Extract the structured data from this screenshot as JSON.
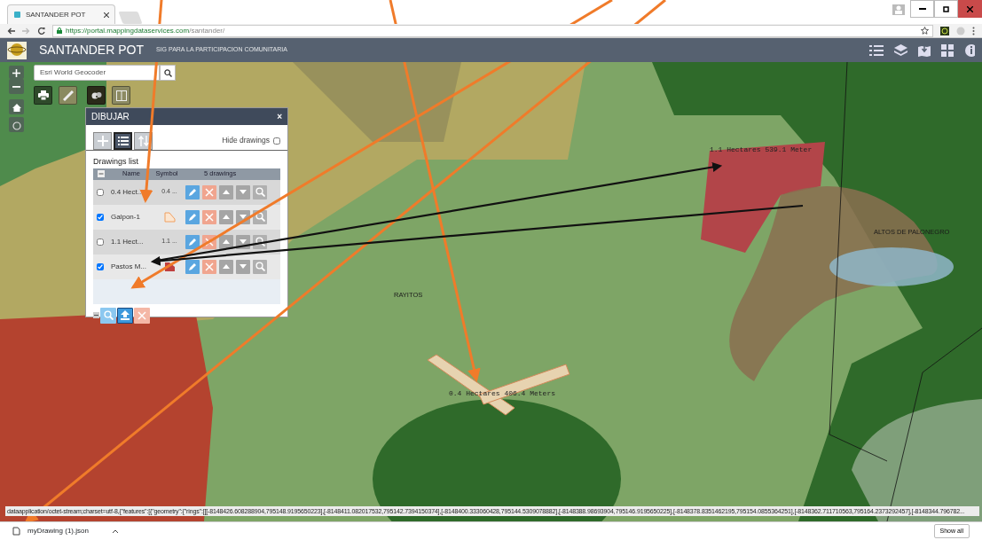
{
  "browser": {
    "tab_title": "SANTANDER POT",
    "url_host": "https://portal.mappingdataservices.com",
    "url_path": "/santander/"
  },
  "app": {
    "title": "SANTANDER POT",
    "subtitle": "SIG PARA LA PARTICIPACION COMUNITARIA"
  },
  "search": {
    "placeholder": "Esri World Geocoder"
  },
  "panel": {
    "title": "DIBUJAR",
    "close": "×",
    "tabs": [
      {
        "kind": "add",
        "selected": false
      },
      {
        "kind": "list",
        "selected": true
      },
      {
        "kind": "import",
        "selected": false
      }
    ],
    "hide_drawings": {
      "label": "Hide drawings",
      "checked": false
    },
    "list_title": "Drawings list",
    "columns": [
      "Name",
      "Symbol",
      "5 drawings"
    ],
    "rows": [
      {
        "name": "0.4 Hect...",
        "checked": false,
        "kind": "text",
        "symbol_text": "0.4 ..."
      },
      {
        "name": "Galpon-1",
        "checked": true,
        "kind": "outline"
      },
      {
        "name": "1.1 Hect...",
        "checked": false,
        "kind": "text",
        "symbol_text": "1.1 ..."
      },
      {
        "name": "Pastos M...",
        "checked": true,
        "kind": "fill"
      }
    ]
  },
  "map_labels": [
    {
      "text": "1.1 Hectares 539.1 Meter",
      "kind": "measure"
    },
    {
      "text": "0.4 Hectares 406.4 Meters",
      "kind": "measure"
    },
    {
      "text": "RAYITOS",
      "kind": "place"
    },
    {
      "text": "ALTOS DE PALONEGRO",
      "kind": "place"
    }
  ],
  "annotations": [
    {
      "color": "#f07b2a"
    },
    {
      "color": "#f07b2a"
    },
    {
      "color": "#f07b2a"
    },
    {
      "color": "#f07b2a"
    },
    {
      "color": "#111111"
    },
    {
      "color": "#111111"
    }
  ],
  "status_text": "dataapplication/octet-stream;charset=utf-8,{\"features\":[{\"geometry\":{\"rings\":[[[-8148426.608288904,795148.9195650223],[-8148411.082017532,795142.7394150374],[-8148400.333060428,795144.5309078882],[-8148388.98693904,795146.9195650225],[-8148378.8351462195,795154.0855364251],[-8148362.711710563,795164.2373292457],[-8148344.796782...",
  "download": {
    "filename": "myDrawing (1).json",
    "show_all": "Show all"
  }
}
